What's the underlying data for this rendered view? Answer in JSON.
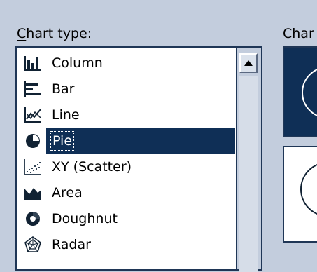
{
  "dialog": {
    "chart_type_label": "Chart type:",
    "chart_type_accel": "C",
    "chart_type_rest": "hart type:",
    "subtype_label": "Char"
  },
  "chart_types": [
    {
      "label": "Column",
      "icon": "column-chart-icon",
      "selected": false
    },
    {
      "label": "Bar",
      "icon": "bar-chart-icon",
      "selected": false
    },
    {
      "label": "Line",
      "icon": "line-chart-icon",
      "selected": false
    },
    {
      "label": "Pie",
      "icon": "pie-chart-icon",
      "selected": true
    },
    {
      "label": "XY (Scatter)",
      "icon": "scatter-chart-icon",
      "selected": false
    },
    {
      "label": "Area",
      "icon": "area-chart-icon",
      "selected": false
    },
    {
      "label": "Doughnut",
      "icon": "doughnut-chart-icon",
      "selected": false
    },
    {
      "label": "Radar",
      "icon": "radar-chart-icon",
      "selected": false
    }
  ],
  "colors": {
    "selection": "#0f2f56",
    "dialog_bg": "#c3cddd",
    "border": "#1f3656"
  }
}
